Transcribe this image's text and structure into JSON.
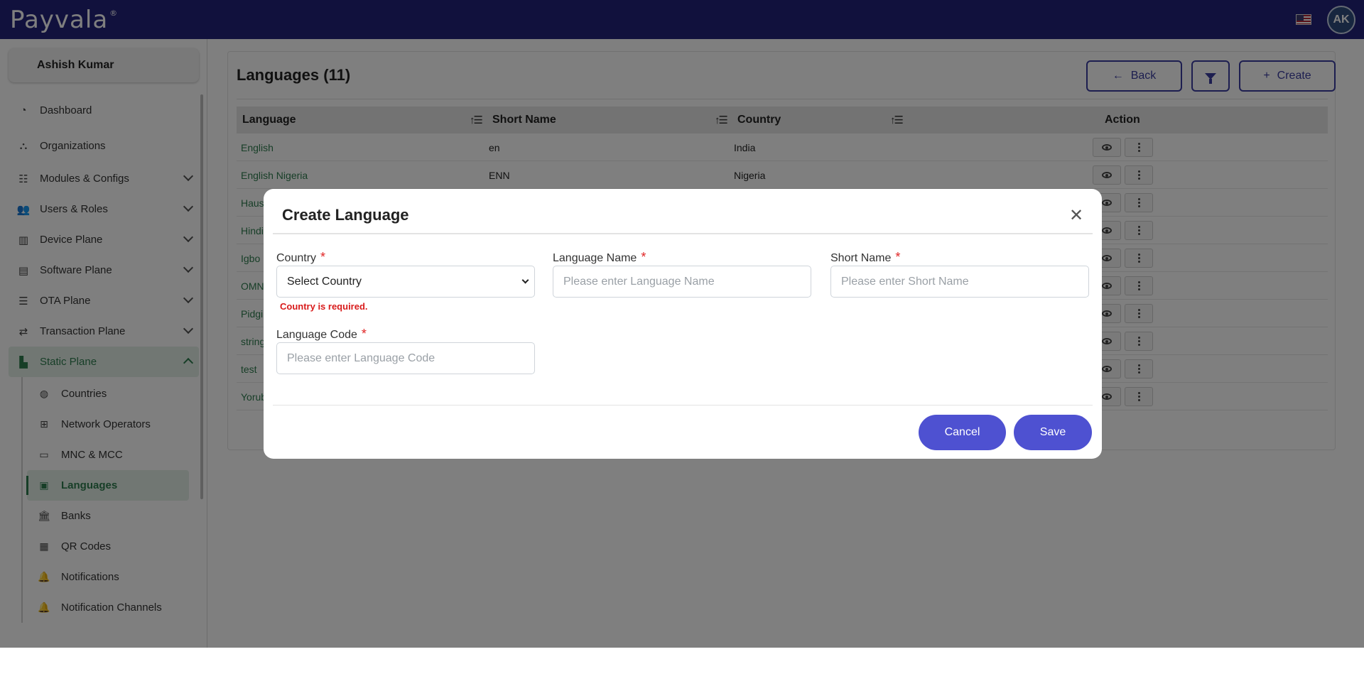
{
  "app": {
    "logo_text": "Payvala",
    "logo_mark": "®",
    "avatar_initials": "AK"
  },
  "sidebar": {
    "user_name": "Ashish Kumar",
    "items": [
      {
        "label": "Dashboard",
        "icon": "dashboard-icon"
      },
      {
        "label": "Organizations",
        "icon": "org-tree-icon"
      },
      {
        "label": "Modules & Configs",
        "icon": "table-icon"
      },
      {
        "label": "Users & Roles",
        "icon": "users-icon"
      },
      {
        "label": "Device Plane",
        "icon": "device-icon"
      },
      {
        "label": "Software Plane",
        "icon": "software-icon"
      },
      {
        "label": "OTA Plane",
        "icon": "ota-icon"
      },
      {
        "label": "Transaction Plane",
        "icon": "transaction-icon"
      },
      {
        "label": "Static Plane",
        "icon": "static-icon"
      }
    ],
    "sub_items": [
      {
        "label": "Countries",
        "icon": "globe-icon"
      },
      {
        "label": "Network Operators",
        "icon": "network-icon"
      },
      {
        "label": "MNC & MCC",
        "icon": "id-card-icon"
      },
      {
        "label": "Languages",
        "icon": "language-icon"
      },
      {
        "label": "Banks",
        "icon": "bank-icon"
      },
      {
        "label": "QR Codes",
        "icon": "qr-icon"
      },
      {
        "label": "Notifications",
        "icon": "bell-icon"
      },
      {
        "label": "Notification Channels",
        "icon": "bell-icon"
      }
    ]
  },
  "main": {
    "title": "Languages (11)",
    "back_label": "Back",
    "create_label": "Create",
    "columns": [
      "Language",
      "Short Name",
      "Country",
      "Action"
    ],
    "rows": [
      {
        "language": "English",
        "short_name": "en",
        "country": "India"
      },
      {
        "language": "English Nigeria",
        "short_name": "ENN",
        "country": "Nigeria"
      },
      {
        "language": "Haus",
        "short_name": "",
        "country": ""
      },
      {
        "language": "Hindi",
        "short_name": "",
        "country": ""
      },
      {
        "language": "Igbo",
        "short_name": "",
        "country": ""
      },
      {
        "language": "OMN",
        "short_name": "",
        "country": ""
      },
      {
        "language": "Pidgi",
        "short_name": "",
        "country": ""
      },
      {
        "language": "string",
        "short_name": "",
        "country": ""
      },
      {
        "language": "test",
        "short_name": "",
        "country": ""
      },
      {
        "language": "Yorub",
        "short_name": "",
        "country": ""
      }
    ]
  },
  "modal": {
    "title": "Create Language",
    "country_label": "Country",
    "country_value": "Select Country",
    "country_error": "Country is required.",
    "language_name_label": "Language Name",
    "language_name_placeholder": "Please enter Language Name",
    "short_name_label": "Short Name",
    "short_name_placeholder": "Please enter Short Name",
    "language_code_label": "Language Code",
    "language_code_placeholder": "Please enter Language Code",
    "required_mark": "*",
    "cancel_label": "Cancel",
    "save_label": "Save"
  },
  "colors": {
    "topbar": "#23237a",
    "accent": "#4e51d1",
    "active_green": "#2e7d4f",
    "error": "#d81b1b"
  }
}
